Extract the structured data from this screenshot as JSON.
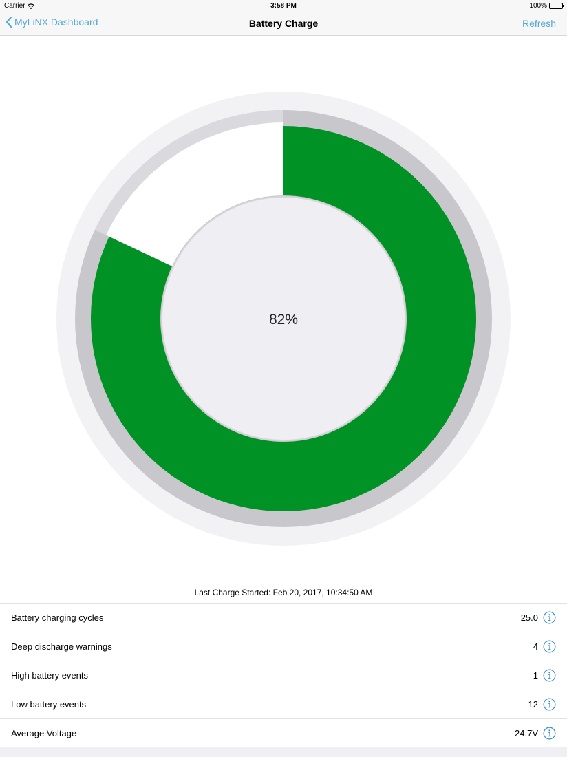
{
  "status_bar": {
    "carrier": "Carrier",
    "time": "3:58 PM",
    "battery_text": "100%"
  },
  "nav": {
    "back_label": "MyLiNX Dashboard",
    "title": "Battery Charge",
    "refresh_label": "Refresh"
  },
  "gauge": {
    "percent_text": "82%",
    "charge_fraction": 0.82,
    "fill_color": "#009225",
    "track_color": "#c8c8cc",
    "face_color": "#efeef3"
  },
  "last_charge": "Last Charge Started: Feb 20, 2017, 10:34:50 AM",
  "stats": [
    {
      "label": "Battery charging cycles",
      "value": "25.0",
      "icon": "info-icon"
    },
    {
      "label": "Deep discharge warnings",
      "value": "4",
      "icon": "info-icon"
    },
    {
      "label": "High battery events",
      "value": "1",
      "icon": "info-icon"
    },
    {
      "label": "Low battery events",
      "value": "12",
      "icon": "info-icon"
    },
    {
      "label": "Average Voltage",
      "value": "24.7V",
      "icon": "info-icon"
    }
  ],
  "colors": {
    "accent": "#53a8d4",
    "info_icon": "#3a8fd6"
  }
}
